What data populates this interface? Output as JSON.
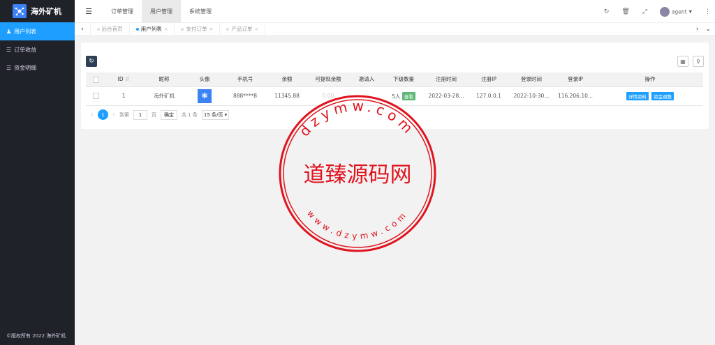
{
  "app": {
    "title": "海外矿机",
    "footer": "©版权所有 2022 海外矿机"
  },
  "sidebar": {
    "items": [
      {
        "label": "用户列表",
        "icon": "users-icon",
        "active": true
      },
      {
        "label": "订单收益",
        "icon": "list-icon",
        "active": false
      },
      {
        "label": "资金明细",
        "icon": "list-icon",
        "active": false
      }
    ]
  },
  "topnav": {
    "items": [
      "订单管理",
      "用户管理",
      "系统管理"
    ],
    "user": "agent"
  },
  "tabs": [
    {
      "label": "后台首页"
    },
    {
      "label": "用户列表"
    },
    {
      "label": "支付订单"
    },
    {
      "label": "产品订单"
    }
  ],
  "table": {
    "headers": [
      "ID",
      "昵称",
      "头像",
      "手机号",
      "余额",
      "可提现余额",
      "邀请人",
      "下级数量",
      "注册时间",
      "注册IP",
      "登录时间",
      "登录IP",
      "操作"
    ],
    "rows": [
      {
        "id": "1",
        "nickname": "海外矿机",
        "phone": "888****8",
        "balance": "11345.88",
        "withdrawable": "0.00",
        "inviter": "",
        "subordinates": "5人",
        "view_btn": "查看",
        "reg_time": "2022-03-28...",
        "reg_ip": "127.0.0.1",
        "login_time": "2022-10-30...",
        "login_ip": "116.206.10...",
        "action1": "详情资料",
        "action2": "资金调整"
      }
    ]
  },
  "pager": {
    "current": "1",
    "goto_label": "到第",
    "goto_value": "1",
    "page_unit": "页",
    "confirm": "确定",
    "total": "共 1 条",
    "per_page": "15 条/页"
  },
  "watermark": {
    "top": "dzymw.com",
    "center": "道臻源码网",
    "bottom": "www.dzymw.com"
  },
  "colors": {
    "accent": "#1e9fff",
    "sidebar": "#20222a",
    "stamp": "#e0141e",
    "green": "#5fb878"
  }
}
